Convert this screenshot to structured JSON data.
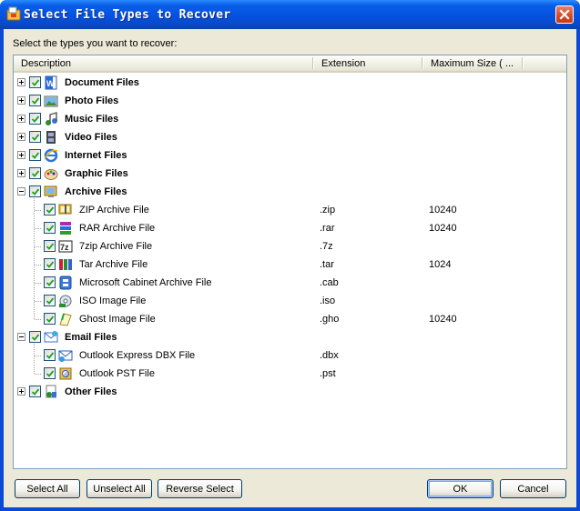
{
  "window": {
    "title": "Select File Types to Recover",
    "prompt": "Select the types you want to recover:"
  },
  "columns": [
    "Description",
    "Extension",
    "Maximum Size ( ..."
  ],
  "rows": [
    {
      "level": 0,
      "expander": "plus",
      "checked": true,
      "icon": "word-document-icon",
      "label": "Document Files",
      "ext": "",
      "size": ""
    },
    {
      "level": 0,
      "expander": "plus",
      "checked": true,
      "icon": "photo-icon",
      "label": "Photo Files",
      "ext": "",
      "size": ""
    },
    {
      "level": 0,
      "expander": "plus",
      "checked": true,
      "icon": "music-icon",
      "label": "Music Files",
      "ext": "",
      "size": ""
    },
    {
      "level": 0,
      "expander": "plus",
      "checked": true,
      "icon": "film-strip-icon",
      "label": "Video Files",
      "ext": "",
      "size": ""
    },
    {
      "level": 0,
      "expander": "plus",
      "checked": true,
      "icon": "internet-explorer-icon",
      "label": "Internet Files",
      "ext": "",
      "size": ""
    },
    {
      "level": 0,
      "expander": "plus",
      "checked": true,
      "icon": "paint-palette-icon",
      "label": "Graphic Files",
      "ext": "",
      "size": ""
    },
    {
      "level": 0,
      "expander": "minus",
      "checked": true,
      "icon": "archive-monitor-icon",
      "label": "Archive Files",
      "ext": "",
      "size": ""
    },
    {
      "level": 1,
      "checked": true,
      "icon": "zip-archive-icon",
      "label": "ZIP Archive File",
      "ext": ".zip",
      "size": "10240"
    },
    {
      "level": 1,
      "checked": true,
      "icon": "rar-archive-icon",
      "label": "RAR Archive File",
      "ext": ".rar",
      "size": "10240"
    },
    {
      "level": 1,
      "checked": true,
      "icon": "7zip-icon",
      "label": "7zip Archive File",
      "ext": ".7z",
      "size": ""
    },
    {
      "level": 1,
      "checked": true,
      "icon": "tar-archive-icon",
      "label": "Tar Archive File",
      "ext": ".tar",
      "size": "1024"
    },
    {
      "level": 1,
      "checked": true,
      "icon": "cabinet-archive-icon",
      "label": "Microsoft Cabinet Archive File",
      "ext": ".cab",
      "size": ""
    },
    {
      "level": 1,
      "checked": true,
      "icon": "disc-image-icon",
      "label": "ISO Image File",
      "ext": ".iso",
      "size": ""
    },
    {
      "level": 1,
      "checked": true,
      "icon": "ghost-image-icon",
      "label": "Ghost Image File",
      "ext": ".gho",
      "size": "10240"
    },
    {
      "level": 0,
      "expander": "minus",
      "checked": true,
      "icon": "email-icon",
      "label": "Email Files",
      "ext": "",
      "size": ""
    },
    {
      "level": 1,
      "checked": true,
      "icon": "outlook-express-icon",
      "label": "Outlook Express DBX File",
      "ext": ".dbx",
      "size": ""
    },
    {
      "level": 1,
      "checked": true,
      "icon": "outlook-pst-icon",
      "label": "Outlook PST File",
      "ext": ".pst",
      "size": ""
    },
    {
      "level": 0,
      "expander": "plus",
      "checked": true,
      "icon": "other-files-icon",
      "label": "Other Files",
      "ext": "",
      "size": ""
    }
  ],
  "buttons": {
    "select_all": "Select All",
    "unselect_all": "Unselect All",
    "reverse_select": "Reverse Select",
    "ok": "OK",
    "cancel": "Cancel"
  },
  "colors": {
    "title_bar": "#0452e0",
    "close_button": "#d8471f",
    "dialog_face": "#ece9d8",
    "check_mark": "#21a121",
    "list_border": "#7f9db9"
  }
}
